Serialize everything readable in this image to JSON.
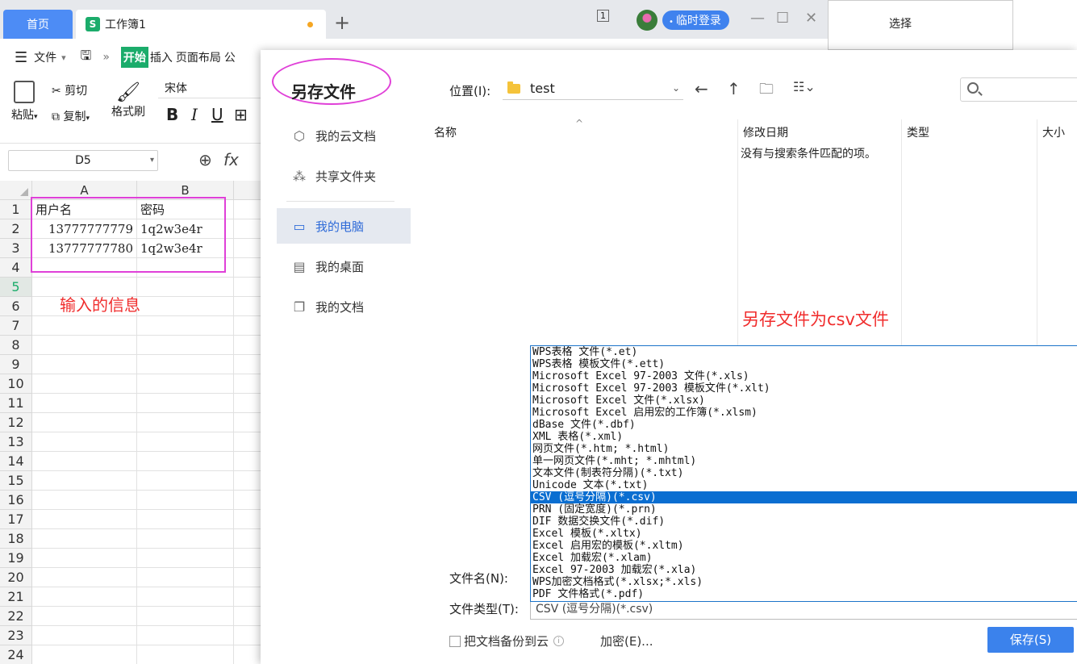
{
  "wps": {
    "tabs": {
      "home": "首页",
      "workbook": "工作簿1"
    },
    "title_right": {
      "page_indicator": "1",
      "login": "临时登录"
    },
    "menu": {
      "file": "文件",
      "start": "开始",
      "insert": "插入",
      "layout": "页面布局",
      "more": "公"
    },
    "ribbon": {
      "paste": "粘贴",
      "cut": "剪切",
      "copy": "复制",
      "format_painter": "格式刷",
      "font": "宋体",
      "bold": "B",
      "italic": "I",
      "underline": "U"
    },
    "namebox": "D5",
    "fx": "fx",
    "columns": [
      "A",
      "B"
    ],
    "rows": [
      {
        "num": "1",
        "a": "用户名",
        "b": "密码"
      },
      {
        "num": "2",
        "a": "13777777779",
        "b": "1q2w3e4r"
      },
      {
        "num": "3",
        "a": "13777777780",
        "b": "1q2w3e4r"
      },
      {
        "num": "4",
        "a": "",
        "b": ""
      },
      {
        "num": "5",
        "a": "",
        "b": ""
      },
      {
        "num": "6",
        "a": "",
        "b": ""
      },
      {
        "num": "7",
        "a": "",
        "b": ""
      },
      {
        "num": "8",
        "a": "",
        "b": ""
      },
      {
        "num": "9",
        "a": "",
        "b": ""
      },
      {
        "num": "10",
        "a": "",
        "b": ""
      },
      {
        "num": "11",
        "a": "",
        "b": ""
      },
      {
        "num": "12",
        "a": "",
        "b": ""
      },
      {
        "num": "13",
        "a": "",
        "b": ""
      },
      {
        "num": "14",
        "a": "",
        "b": ""
      },
      {
        "num": "15",
        "a": "",
        "b": ""
      },
      {
        "num": "16",
        "a": "",
        "b": ""
      },
      {
        "num": "17",
        "a": "",
        "b": ""
      },
      {
        "num": "18",
        "a": "",
        "b": ""
      },
      {
        "num": "19",
        "a": "",
        "b": ""
      },
      {
        "num": "20",
        "a": "",
        "b": ""
      },
      {
        "num": "21",
        "a": "",
        "b": ""
      },
      {
        "num": "22",
        "a": "",
        "b": ""
      },
      {
        "num": "23",
        "a": "",
        "b": ""
      },
      {
        "num": "24",
        "a": "",
        "b": ""
      }
    ],
    "annotation": "输入的信息"
  },
  "background_panel": {
    "select_label": "选择"
  },
  "dialog": {
    "title": "另存文件",
    "sidebar": [
      {
        "icon": "cloud-docs-icon",
        "label": "我的云文档"
      },
      {
        "icon": "shared-folder-icon",
        "label": "共享文件夹"
      },
      {
        "icon": "computer-icon",
        "label": "我的电脑"
      },
      {
        "icon": "desktop-icon",
        "label": "我的桌面"
      },
      {
        "icon": "documents-icon",
        "label": "我的文档"
      }
    ],
    "location_label": "位置(I):",
    "location_value": "test",
    "columns": {
      "name": "名称",
      "modified": "修改日期",
      "type": "类型",
      "size": "大小"
    },
    "empty_message": "没有与搜索条件匹配的项。",
    "annotation": "另存文件为csv文件",
    "file_types": [
      "WPS表格 文件(*.et)",
      "WPS表格 模板文件(*.ett)",
      "Microsoft Excel 97-2003 文件(*.xls)",
      "Microsoft Excel 97-2003 模板文件(*.xlt)",
      "Microsoft Excel 文件(*.xlsx)",
      "Microsoft Excel 启用宏的工作簿(*.xlsm)",
      "dBase 文件(*.dbf)",
      "XML 表格(*.xml)",
      "网页文件(*.htm; *.html)",
      "单一网页文件(*.mht; *.mhtml)",
      "文本文件(制表符分隔)(*.txt)",
      "Unicode 文本(*.txt)",
      "CSV (逗号分隔)(*.csv)",
      "PRN (固定宽度)(*.prn)",
      "DIF 数据交换文件(*.dif)",
      "Excel 模板(*.xltx)",
      "Excel 启用宏的模板(*.xltm)",
      "Excel 加载宏(*.xlam)",
      "Excel 97-2003 加载宏(*.xla)",
      "WPS加密文档格式(*.xlsx;*.xls)",
      "PDF 文件格式(*.pdf)"
    ],
    "selected_type_index": 12,
    "filename_label": "文件名(N):",
    "filetype_label": "文件类型(T):",
    "filetype_value": "CSV (逗号分隔)(*.csv)",
    "backup_label": "把文档备份到云",
    "encrypt_label": "加密(E)...",
    "save_label": "保存(S)"
  },
  "colors": {
    "accent": "#3b82ec",
    "annotation": "#f02d2d",
    "highlight": "#e040d8",
    "selected_row": "#0a6ed1"
  }
}
